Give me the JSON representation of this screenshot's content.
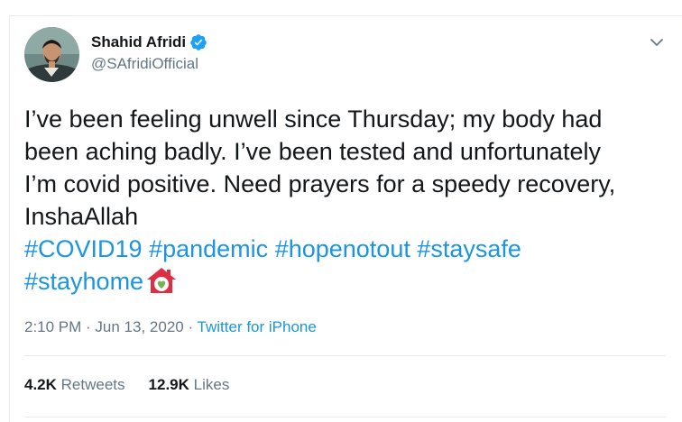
{
  "tweet": {
    "author": {
      "display_name": "Shahid Afridi",
      "handle": "@SAfridiOfficial",
      "verified_icon": "verified-badge-icon"
    },
    "text_lines": [
      "I’ve been feeling unwell since Thursday; my body had",
      "been aching badly. I’ve been tested and unfortunately",
      "I’m covid positive. Need prayers for a speedy recovery,",
      "InshaAllah"
    ],
    "hashtags": {
      "covid19": "#COVID19",
      "pandemic": "#pandemic",
      "hopenotout": "#hopenotout",
      "staysafe": "#staysafe",
      "stayhome": "#stayhome"
    },
    "emoji": "house-with-heart-emoji",
    "timestamp": "2:10 PM · Jun 13, 2020",
    "separator": " · ",
    "source": "Twitter for iPhone",
    "stats": {
      "retweets_count": "4.2K",
      "retweets_label": "Retweets",
      "likes_count": "12.9K",
      "likes_label": "Likes"
    }
  },
  "colors": {
    "link": "#1b95e0",
    "text": "#14171a",
    "secondary": "#657786",
    "border": "#e6ecf0"
  }
}
